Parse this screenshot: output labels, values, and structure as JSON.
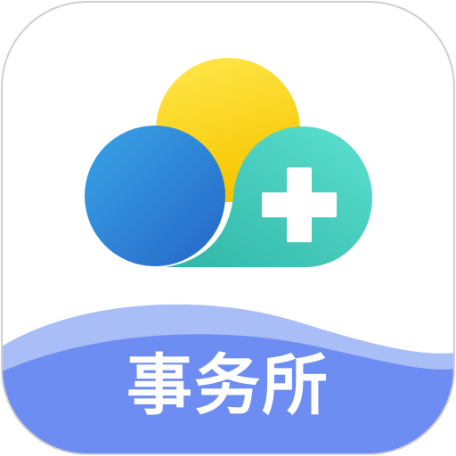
{
  "app_icon": {
    "label": "事务所",
    "logo": "cloud-sun-plus-icon",
    "colors": {
      "sun_top": "#FFE84D",
      "sun_bottom": "#F7C600",
      "blue_light": "#3AA4E6",
      "blue_dark": "#2466C8",
      "teal_light": "#5CE0D0",
      "teal_dark": "#2FB5A6",
      "wave_front": "#6E8DF2",
      "wave_back": "#A9BEF7",
      "border": "#CFCFCF",
      "plus": "#FFFFFF"
    }
  }
}
